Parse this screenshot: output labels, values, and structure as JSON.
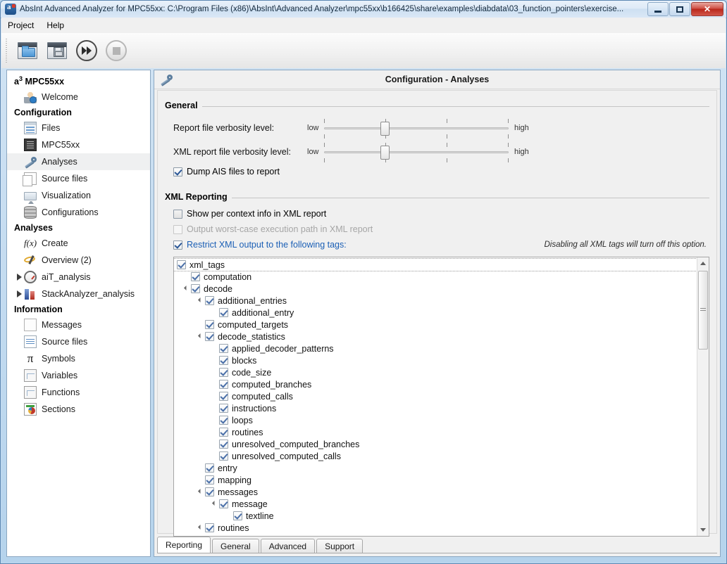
{
  "window": {
    "title": "AbsInt Advanced Analyzer for MPC55xx: C:\\Program Files (x86)\\AbsInt\\Advanced Analyzer\\mpc55xx\\b166425\\share\\examples\\diabdata\\03_function_pointers\\exercise...",
    "icon": "app-icon",
    "buttons": {
      "minimize": "minimize-button",
      "maximize": "maximize-button",
      "close": "✕"
    }
  },
  "menu": {
    "items": [
      {
        "label": "Project"
      },
      {
        "label": "Help"
      }
    ]
  },
  "toolbar": {
    "buttons": [
      {
        "name": "open-project-button",
        "icon": "open-folder-icon"
      },
      {
        "name": "save-project-button",
        "icon": "save-floppy-icon"
      },
      {
        "name": "run-analysis-button",
        "icon": "fast-forward-icon"
      },
      {
        "name": "stop-analysis-button",
        "icon": "stop-square-icon"
      }
    ]
  },
  "sidebar": {
    "root": {
      "label": "MPC55xx",
      "prefix": "a",
      "superscript": "3"
    },
    "groups": [
      {
        "header": null,
        "items": [
          {
            "label": "Welcome",
            "icon": "welcome-user-icon",
            "arrow": false,
            "selected": false
          }
        ]
      },
      {
        "header": "Configuration",
        "items": [
          {
            "label": "Files",
            "icon": "files-list-icon",
            "arrow": false,
            "selected": false
          },
          {
            "label": "MPC55xx",
            "icon": "chip-icon",
            "arrow": false,
            "selected": false
          },
          {
            "label": "Analyses",
            "icon": "wrench-icon",
            "arrow": false,
            "selected": true
          },
          {
            "label": "Source files",
            "icon": "source-files-icon",
            "arrow": false,
            "selected": false
          },
          {
            "label": "Visualization",
            "icon": "monitor-icon",
            "arrow": false,
            "selected": false
          },
          {
            "label": "Configurations",
            "icon": "database-stack-icon",
            "arrow": false,
            "selected": false
          }
        ]
      },
      {
        "header": "Analyses",
        "items": [
          {
            "label": "Create",
            "icon": "fx-icon",
            "arrow": false,
            "selected": false
          },
          {
            "label": "Overview (2)",
            "icon": "overview-wand-icon",
            "arrow": false,
            "selected": false
          },
          {
            "label": "aiT_analysis",
            "icon": "stopwatch-icon",
            "arrow": true,
            "selected": false
          },
          {
            "label": "StackAnalyzer_analysis",
            "icon": "bar-chart-icon",
            "arrow": true,
            "selected": false
          }
        ]
      },
      {
        "header": "Information",
        "items": [
          {
            "label": "Messages",
            "icon": "message-page-icon",
            "arrow": false,
            "selected": false
          },
          {
            "label": "Source files",
            "icon": "source-lines-icon",
            "arrow": false,
            "selected": false
          },
          {
            "label": "Symbols",
            "icon": "pi-icon",
            "arrow": false,
            "selected": false
          },
          {
            "label": "Variables",
            "icon": "table-grid-icon",
            "arrow": false,
            "selected": false
          },
          {
            "label": "Functions",
            "icon": "table-grid-icon",
            "arrow": false,
            "selected": false
          },
          {
            "label": "Sections",
            "icon": "sections-pie-icon",
            "arrow": false,
            "selected": false
          }
        ]
      }
    ]
  },
  "pane": {
    "title": "Configuration - Analyses",
    "header_icon": "wrench-icon",
    "general": {
      "label": "General",
      "sliders": [
        {
          "label": "Report file verbosity level:",
          "low": "low",
          "high": "high",
          "value_pct": 33
        },
        {
          "label": "XML report file verbosity level:",
          "low": "low",
          "high": "high",
          "value_pct": 33
        }
      ],
      "checkbox": {
        "label": "Dump AIS files to report",
        "checked": true,
        "disabled": false
      }
    },
    "xml_reporting": {
      "label": "XML Reporting",
      "checkboxes": [
        {
          "label": "Show per context info in XML report",
          "checked": false,
          "disabled": false,
          "link": false
        },
        {
          "label": "Output worst-case execution path in XML report",
          "checked": false,
          "disabled": true,
          "link": false
        },
        {
          "label": "Restrict XML output to the following tags:",
          "checked": true,
          "disabled": false,
          "link": true
        }
      ],
      "hint": "Disabling all XML tags will turn off this option."
    },
    "tree": {
      "nodes": [
        {
          "label": "xml_tags",
          "level": 0,
          "expander": false,
          "checked": true,
          "selected": true
        },
        {
          "label": "computation",
          "level": 1,
          "expander": false,
          "checked": true,
          "selected": false
        },
        {
          "label": "decode",
          "level": 1,
          "expander": true,
          "checked": true,
          "selected": false
        },
        {
          "label": "additional_entries",
          "level": 2,
          "expander": true,
          "checked": true,
          "selected": false
        },
        {
          "label": "additional_entry",
          "level": 3,
          "expander": false,
          "checked": true,
          "selected": false
        },
        {
          "label": "computed_targets",
          "level": 2,
          "expander": false,
          "checked": true,
          "selected": false
        },
        {
          "label": "decode_statistics",
          "level": 2,
          "expander": true,
          "checked": true,
          "selected": false
        },
        {
          "label": "applied_decoder_patterns",
          "level": 3,
          "expander": false,
          "checked": true,
          "selected": false
        },
        {
          "label": "blocks",
          "level": 3,
          "expander": false,
          "checked": true,
          "selected": false
        },
        {
          "label": "code_size",
          "level": 3,
          "expander": false,
          "checked": true,
          "selected": false
        },
        {
          "label": "computed_branches",
          "level": 3,
          "expander": false,
          "checked": true,
          "selected": false
        },
        {
          "label": "computed_calls",
          "level": 3,
          "expander": false,
          "checked": true,
          "selected": false
        },
        {
          "label": "instructions",
          "level": 3,
          "expander": false,
          "checked": true,
          "selected": false
        },
        {
          "label": "loops",
          "level": 3,
          "expander": false,
          "checked": true,
          "selected": false
        },
        {
          "label": "routines",
          "level": 3,
          "expander": false,
          "checked": true,
          "selected": false
        },
        {
          "label": "unresolved_computed_branches",
          "level": 3,
          "expander": false,
          "checked": true,
          "selected": false
        },
        {
          "label": "unresolved_computed_calls",
          "level": 3,
          "expander": false,
          "checked": true,
          "selected": false
        },
        {
          "label": "entry",
          "level": 2,
          "expander": false,
          "checked": true,
          "selected": false
        },
        {
          "label": "mapping",
          "level": 2,
          "expander": false,
          "checked": true,
          "selected": false
        },
        {
          "label": "messages",
          "level": 2,
          "expander": true,
          "checked": true,
          "selected": false
        },
        {
          "label": "message",
          "level": 3,
          "expander": true,
          "checked": true,
          "selected": false
        },
        {
          "label": "textline",
          "level": 4,
          "expander": false,
          "checked": true,
          "selected": false
        },
        {
          "label": "routines",
          "level": 2,
          "expander": true,
          "checked": true,
          "selected": false
        }
      ],
      "scrollbar": {
        "up": "scroll-up-arrow",
        "down": "scroll-down-arrow"
      }
    },
    "tabs": [
      {
        "label": "Reporting",
        "active": true
      },
      {
        "label": "General",
        "active": false
      },
      {
        "label": "Advanced",
        "active": false
      },
      {
        "label": "Support",
        "active": false
      }
    ]
  },
  "colors": {
    "accent": "#1b5fb5",
    "close_button": "#b9271b",
    "checkbox_check": "#2b5797",
    "selection_bg": "#eff0f1"
  }
}
